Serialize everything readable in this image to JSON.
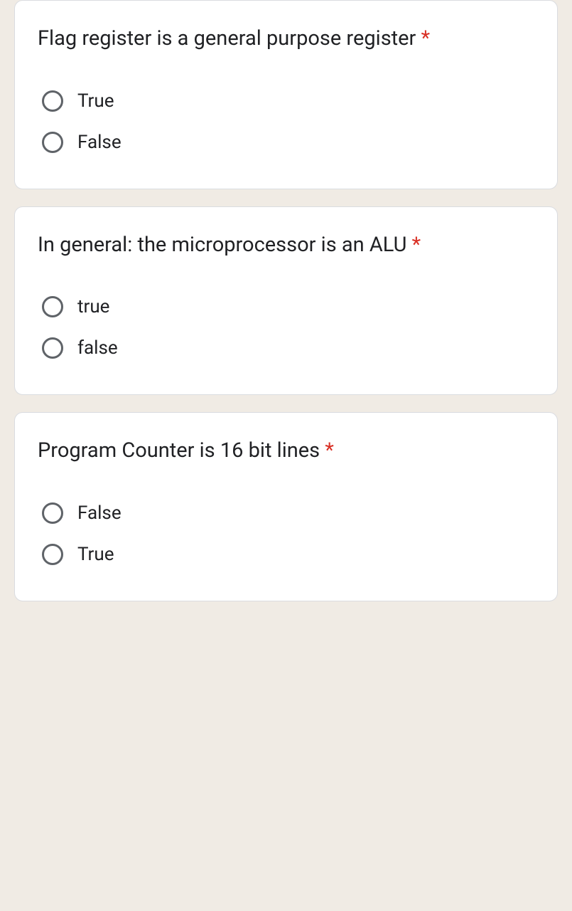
{
  "questions": [
    {
      "text": "Flag register is a general purpose register",
      "required": "*",
      "options": [
        "True",
        "False"
      ]
    },
    {
      "text": "In general: the microprocessor is an ALU",
      "required": "*",
      "options": [
        "true",
        "false"
      ]
    },
    {
      "text": "Program Counter is 16 bit lines",
      "required": "*",
      "options": [
        "False",
        "True"
      ]
    }
  ]
}
